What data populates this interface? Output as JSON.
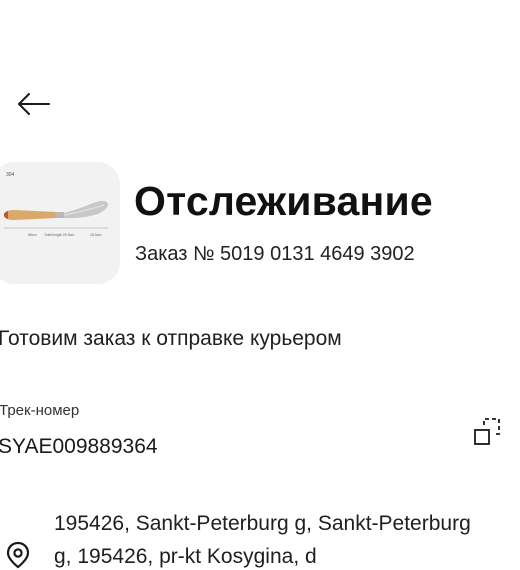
{
  "header": {
    "back_icon": "arrow-left-icon",
    "title": "Отслеживание",
    "order_number": "Заказ № 5019 0131 4649 3902"
  },
  "product": {
    "image": "palette-knife-product-image",
    "image_caption_tl": "304",
    "image_caption_1": "68cm",
    "image_caption_2": "Total length 25.5cm",
    "image_caption_3": "18.5cm"
  },
  "status": {
    "text": "Готовим заказ к отправке курьером"
  },
  "tracking": {
    "label": "Трек-номер",
    "number": "SYAE009889364",
    "copy_icon": "copy-icon"
  },
  "address": {
    "icon": "location-pin-icon",
    "text": "195426, Sankt-Peterburg g, Sankt-Peterburg g, 195426, pr-kt Kosygina, d"
  }
}
